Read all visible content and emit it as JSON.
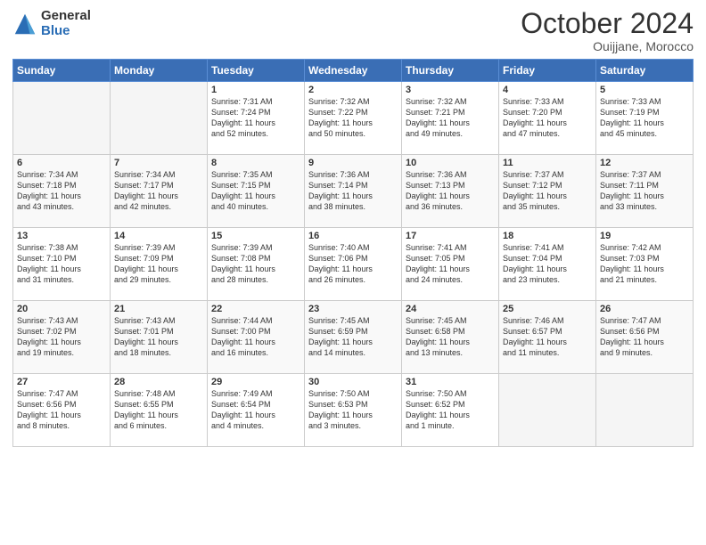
{
  "logo": {
    "general": "General",
    "blue": "Blue"
  },
  "header": {
    "month": "October 2024",
    "location": "Ouijjane, Morocco"
  },
  "weekdays": [
    "Sunday",
    "Monday",
    "Tuesday",
    "Wednesday",
    "Thursday",
    "Friday",
    "Saturday"
  ],
  "weeks": [
    [
      {
        "day": "",
        "info": ""
      },
      {
        "day": "",
        "info": ""
      },
      {
        "day": "1",
        "info": "Sunrise: 7:31 AM\nSunset: 7:24 PM\nDaylight: 11 hours\nand 52 minutes."
      },
      {
        "day": "2",
        "info": "Sunrise: 7:32 AM\nSunset: 7:22 PM\nDaylight: 11 hours\nand 50 minutes."
      },
      {
        "day": "3",
        "info": "Sunrise: 7:32 AM\nSunset: 7:21 PM\nDaylight: 11 hours\nand 49 minutes."
      },
      {
        "day": "4",
        "info": "Sunrise: 7:33 AM\nSunset: 7:20 PM\nDaylight: 11 hours\nand 47 minutes."
      },
      {
        "day": "5",
        "info": "Sunrise: 7:33 AM\nSunset: 7:19 PM\nDaylight: 11 hours\nand 45 minutes."
      }
    ],
    [
      {
        "day": "6",
        "info": "Sunrise: 7:34 AM\nSunset: 7:18 PM\nDaylight: 11 hours\nand 43 minutes."
      },
      {
        "day": "7",
        "info": "Sunrise: 7:34 AM\nSunset: 7:17 PM\nDaylight: 11 hours\nand 42 minutes."
      },
      {
        "day": "8",
        "info": "Sunrise: 7:35 AM\nSunset: 7:15 PM\nDaylight: 11 hours\nand 40 minutes."
      },
      {
        "day": "9",
        "info": "Sunrise: 7:36 AM\nSunset: 7:14 PM\nDaylight: 11 hours\nand 38 minutes."
      },
      {
        "day": "10",
        "info": "Sunrise: 7:36 AM\nSunset: 7:13 PM\nDaylight: 11 hours\nand 36 minutes."
      },
      {
        "day": "11",
        "info": "Sunrise: 7:37 AM\nSunset: 7:12 PM\nDaylight: 11 hours\nand 35 minutes."
      },
      {
        "day": "12",
        "info": "Sunrise: 7:37 AM\nSunset: 7:11 PM\nDaylight: 11 hours\nand 33 minutes."
      }
    ],
    [
      {
        "day": "13",
        "info": "Sunrise: 7:38 AM\nSunset: 7:10 PM\nDaylight: 11 hours\nand 31 minutes."
      },
      {
        "day": "14",
        "info": "Sunrise: 7:39 AM\nSunset: 7:09 PM\nDaylight: 11 hours\nand 29 minutes."
      },
      {
        "day": "15",
        "info": "Sunrise: 7:39 AM\nSunset: 7:08 PM\nDaylight: 11 hours\nand 28 minutes."
      },
      {
        "day": "16",
        "info": "Sunrise: 7:40 AM\nSunset: 7:06 PM\nDaylight: 11 hours\nand 26 minutes."
      },
      {
        "day": "17",
        "info": "Sunrise: 7:41 AM\nSunset: 7:05 PM\nDaylight: 11 hours\nand 24 minutes."
      },
      {
        "day": "18",
        "info": "Sunrise: 7:41 AM\nSunset: 7:04 PM\nDaylight: 11 hours\nand 23 minutes."
      },
      {
        "day": "19",
        "info": "Sunrise: 7:42 AM\nSunset: 7:03 PM\nDaylight: 11 hours\nand 21 minutes."
      }
    ],
    [
      {
        "day": "20",
        "info": "Sunrise: 7:43 AM\nSunset: 7:02 PM\nDaylight: 11 hours\nand 19 minutes."
      },
      {
        "day": "21",
        "info": "Sunrise: 7:43 AM\nSunset: 7:01 PM\nDaylight: 11 hours\nand 18 minutes."
      },
      {
        "day": "22",
        "info": "Sunrise: 7:44 AM\nSunset: 7:00 PM\nDaylight: 11 hours\nand 16 minutes."
      },
      {
        "day": "23",
        "info": "Sunrise: 7:45 AM\nSunset: 6:59 PM\nDaylight: 11 hours\nand 14 minutes."
      },
      {
        "day": "24",
        "info": "Sunrise: 7:45 AM\nSunset: 6:58 PM\nDaylight: 11 hours\nand 13 minutes."
      },
      {
        "day": "25",
        "info": "Sunrise: 7:46 AM\nSunset: 6:57 PM\nDaylight: 11 hours\nand 11 minutes."
      },
      {
        "day": "26",
        "info": "Sunrise: 7:47 AM\nSunset: 6:56 PM\nDaylight: 11 hours\nand 9 minutes."
      }
    ],
    [
      {
        "day": "27",
        "info": "Sunrise: 7:47 AM\nSunset: 6:56 PM\nDaylight: 11 hours\nand 8 minutes."
      },
      {
        "day": "28",
        "info": "Sunrise: 7:48 AM\nSunset: 6:55 PM\nDaylight: 11 hours\nand 6 minutes."
      },
      {
        "day": "29",
        "info": "Sunrise: 7:49 AM\nSunset: 6:54 PM\nDaylight: 11 hours\nand 4 minutes."
      },
      {
        "day": "30",
        "info": "Sunrise: 7:50 AM\nSunset: 6:53 PM\nDaylight: 11 hours\nand 3 minutes."
      },
      {
        "day": "31",
        "info": "Sunrise: 7:50 AM\nSunset: 6:52 PM\nDaylight: 11 hours\nand 1 minute."
      },
      {
        "day": "",
        "info": ""
      },
      {
        "day": "",
        "info": ""
      }
    ]
  ]
}
